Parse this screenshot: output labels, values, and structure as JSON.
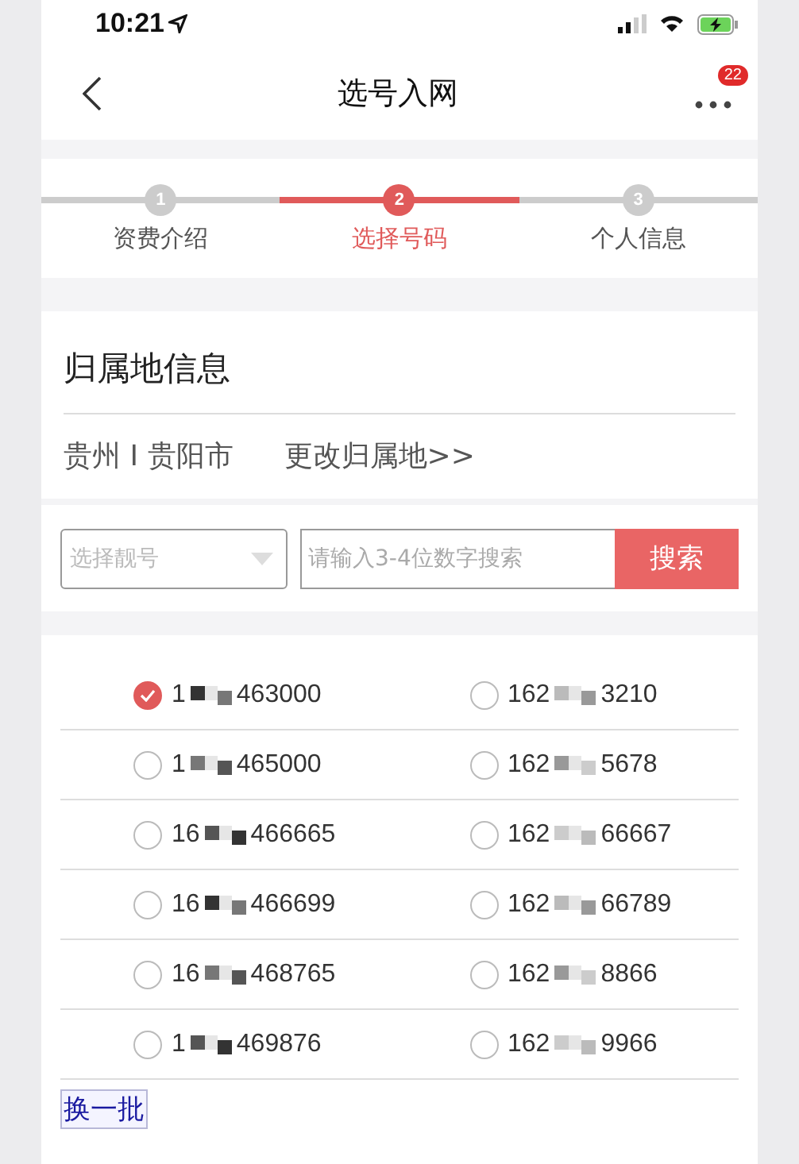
{
  "status_bar": {
    "time": "10:21"
  },
  "nav": {
    "title": "选号入网",
    "badge": "22"
  },
  "steps": [
    {
      "number": "1",
      "label": "资费介绍",
      "selected": false
    },
    {
      "number": "2",
      "label": "选择号码",
      "selected": true
    },
    {
      "number": "3",
      "label": "个人信息",
      "selected": false
    }
  ],
  "location": {
    "heading": "归属地信息",
    "region": "贵州 I 贵阳市",
    "change_link": "更改归属地>>"
  },
  "search": {
    "select_placeholder": "选择靓号",
    "placeholder": "请输入3-4位数字搜索",
    "button": "搜索"
  },
  "numbers": [
    {
      "prefix": "1",
      "suffix": "463000",
      "selected": true
    },
    {
      "prefix": "162",
      "suffix": "3210",
      "selected": false
    },
    {
      "prefix": "1",
      "suffix": "465000",
      "selected": false
    },
    {
      "prefix": "162",
      "suffix": "5678",
      "selected": false
    },
    {
      "prefix": "16",
      "suffix": "466665",
      "selected": false
    },
    {
      "prefix": "162",
      "suffix": "66667",
      "selected": false
    },
    {
      "prefix": "16",
      "suffix": "466699",
      "selected": false
    },
    {
      "prefix": "162",
      "suffix": "66789",
      "selected": false
    },
    {
      "prefix": "16",
      "suffix": "468765",
      "selected": false
    },
    {
      "prefix": "162",
      "suffix": "8866",
      "selected": false
    },
    {
      "prefix": "1",
      "suffix": "469876",
      "selected": false
    },
    {
      "prefix": "162",
      "suffix": "9966",
      "selected": false
    }
  ],
  "refresh_button": "换一批"
}
